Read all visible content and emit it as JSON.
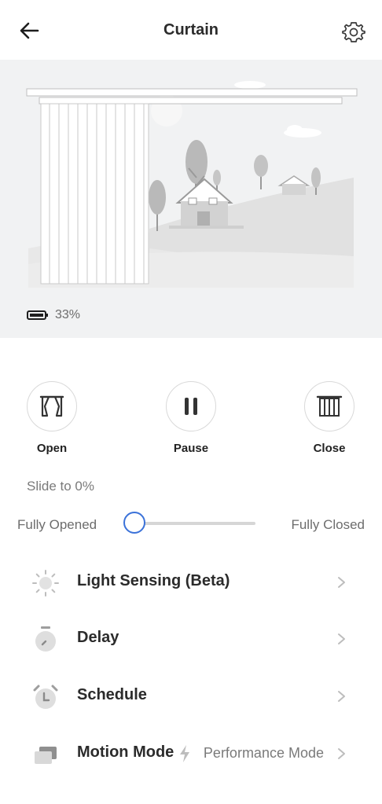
{
  "header": {
    "title": "Curtain"
  },
  "status": {
    "battery": "33%"
  },
  "controls": {
    "open": "Open",
    "pause": "Pause",
    "close": "Close"
  },
  "slider": {
    "caption": "Slide to 0%",
    "left_label": "Fully Opened",
    "right_label": "Fully Closed",
    "value_percent": 0
  },
  "menu": [
    {
      "label": "Light Sensing (Beta)",
      "value": ""
    },
    {
      "label": "Delay",
      "value": ""
    },
    {
      "label": "Schedule",
      "value": ""
    },
    {
      "label": "Motion Mode",
      "value": "Performance Mode"
    }
  ],
  "colors": {
    "accent": "#3b72d9"
  }
}
